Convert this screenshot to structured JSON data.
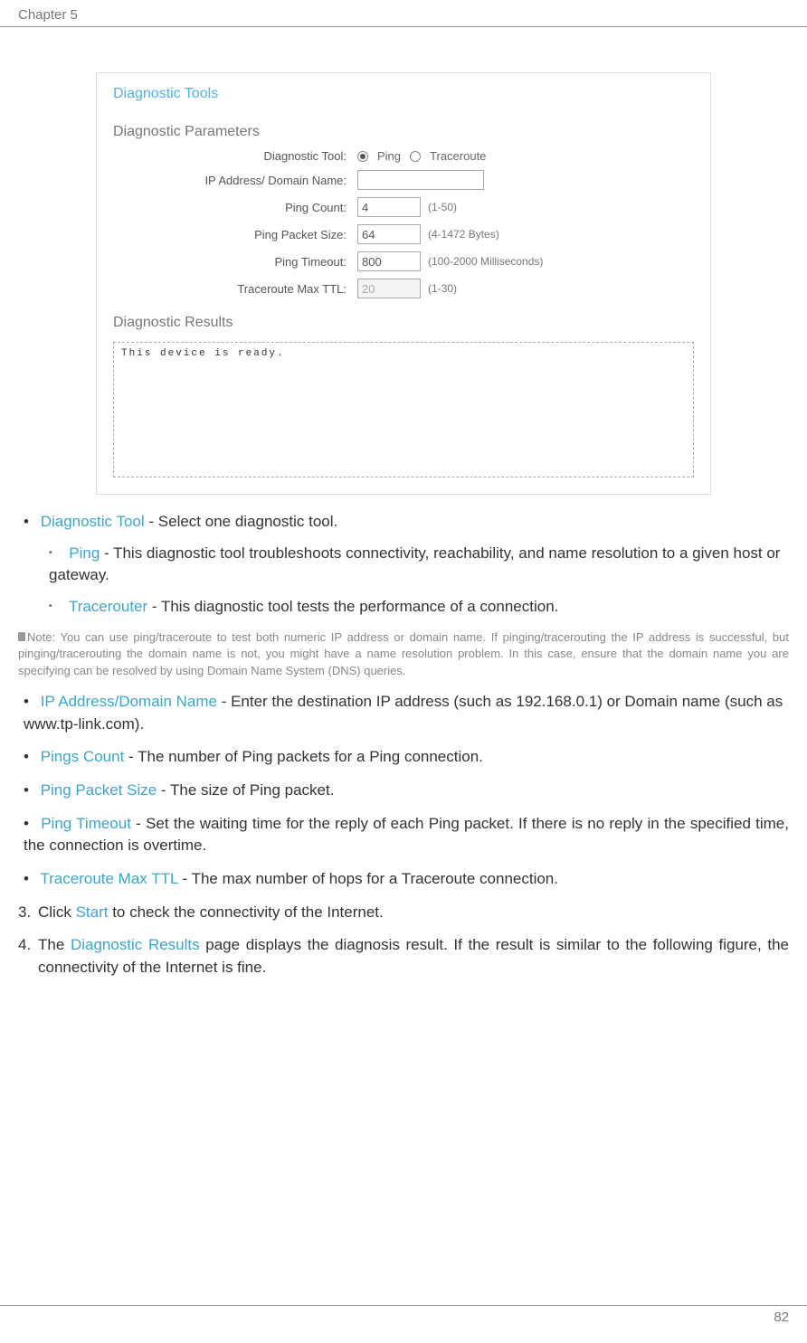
{
  "header": {
    "chapter": "Chapter 5 "
  },
  "panel": {
    "title": "Diagnostic Tools",
    "params_title": "Diagnostic Parameters",
    "rows": {
      "tool": {
        "label": "Diagnostic Tool:",
        "opt1": "Ping",
        "opt2": "Traceroute"
      },
      "ip": {
        "label": "IP Address/ Domain Name:",
        "value": ""
      },
      "count": {
        "label": "Ping Count:",
        "value": "4",
        "hint": "(1-50)"
      },
      "size": {
        "label": "Ping Packet Size:",
        "value": "64",
        "hint": "(4-1472 Bytes)"
      },
      "timeout": {
        "label": "Ping Timeout:",
        "value": "800",
        "hint": "(100-2000 Milliseconds)"
      },
      "ttl": {
        "label": "Traceroute Max TTL:",
        "value": "20",
        "hint": "(1-30)"
      }
    },
    "results_title": "Diagnostic Results",
    "results_text": "This device is ready."
  },
  "doc": {
    "diag_tool_kw": "Diagnostic Tool",
    "diag_tool_txt": " - Select one diagnostic tool.",
    "ping_kw": "Ping",
    "ping_txt": " - This diagnostic tool troubleshoots connectivity, reachability, and name resolution to a given host or gateway.",
    "trace_kw": "Tracerouter",
    "trace_txt": " - This diagnostic tool tests the performance of a connection.",
    "note_label": "Note:",
    "note_txt": " You can use ping/traceroute to test both numeric IP address or domain name. If pinging/tracerouting the IP address is successful, but pinging/tracerouting the domain name is not, you might have a name resolution problem. In this case, ensure that the domain name you are specifying can be resolved by using Domain Name System (DNS) queries.",
    "ip_kw": "IP Address/Domain Name",
    "ip_txt": " - Enter the destination IP address (such as 192.168.0.1) or Domain name (such as www.tp-link.com).",
    "count_kw": "Pings Count",
    "count_txt": " - The number of Ping packets for a Ping connection.",
    "size_kw": "Ping Packet Size",
    "size_txt": " - The size of Ping packet.",
    "timeout_kw": "Ping Timeout",
    "timeout_txt": " - Set the waiting time for the reply of each Ping packet. If there is no reply in the specified time, the connection is overtime.",
    "ttl_kw": "Traceroute Max TTL",
    "ttl_txt": " - The max number of hops for a Traceroute connection.",
    "step3_num": "3.",
    "step3_a": "Click ",
    "step3_kw": "Start",
    "step3_b": " to check the connectivity of the Internet.",
    "step4_num": "4.",
    "step4_a": "The ",
    "step4_kw": "Diagnostic Results",
    "step4_b": " page displays the diagnosis result. If the result is similar to the following figure, the connectivity of the Internet is fine."
  },
  "footer": {
    "page": "82"
  }
}
